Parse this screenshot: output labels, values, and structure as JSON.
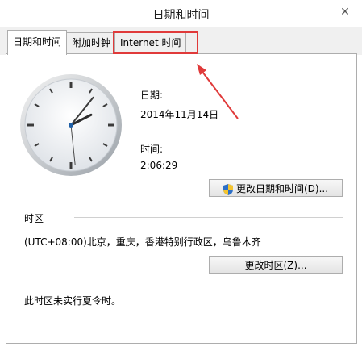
{
  "window": {
    "title": "日期和时间",
    "close_glyph": "✕"
  },
  "tabs": [
    {
      "label": "日期和时间",
      "active": true
    },
    {
      "label": "附加时钟",
      "active": false
    },
    {
      "label": "Internet 时间",
      "active": false
    }
  ],
  "date": {
    "label": "日期:",
    "value": "2014年11月14日"
  },
  "time": {
    "label": "时间:",
    "value": "2:06:29"
  },
  "buttons": {
    "change_datetime": "更改日期和时间(D)...",
    "change_timezone": "更改时区(Z)..."
  },
  "timezone": {
    "section_label": "时区",
    "value": "(UTC+08:00)北京，重庆，香港特别行政区，乌鲁木齐",
    "dst_note": "此时区未实行夏令时。"
  },
  "clock": {
    "hours": 2,
    "minutes": 6,
    "seconds": 29
  },
  "colors": {
    "annotation": "#e03a3a",
    "accent": "#1f5fa6"
  }
}
